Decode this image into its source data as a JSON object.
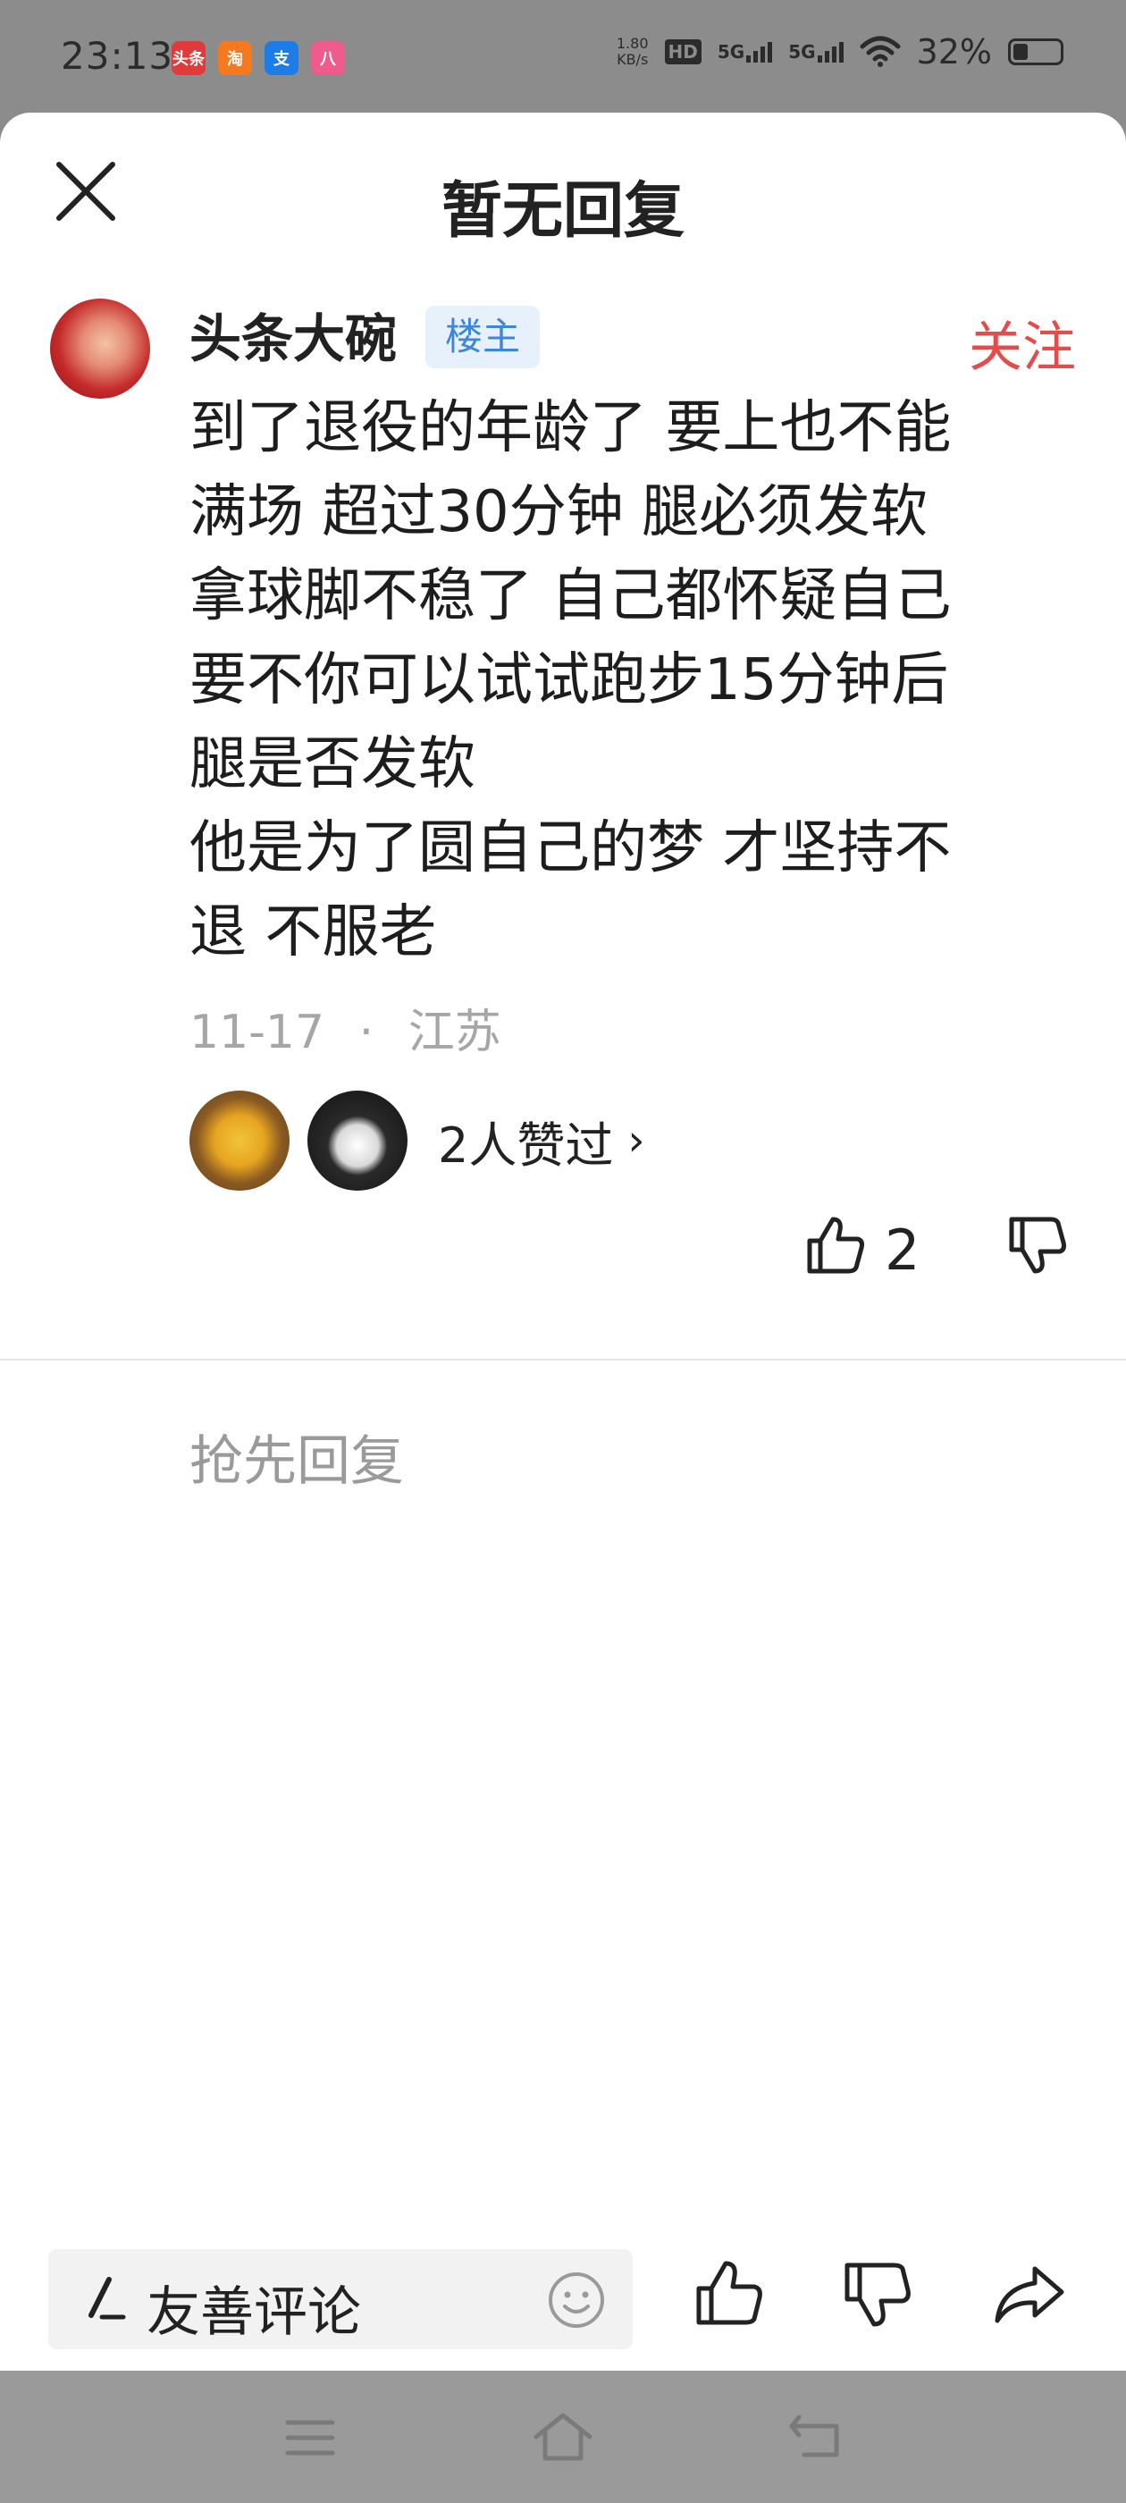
{
  "status_bar": {
    "time": "23:13",
    "apps": [
      {
        "label": "头条",
        "color": "#e03a3a"
      },
      {
        "label": "淘",
        "color": "#f57a1f"
      },
      {
        "label": "支",
        "color": "#1e7ce8"
      },
      {
        "label": "八",
        "color": "#ef5b8d"
      }
    ],
    "network_speed_value": "1.80",
    "network_speed_unit": "KB/s",
    "hd_label": "HD",
    "sim1_label": "5G",
    "sim2_label": "5G",
    "battery": "32%"
  },
  "sheet": {
    "title": "暂无回复"
  },
  "comment": {
    "username": "头条大碗",
    "badge": "楼主",
    "follow_label": "关注",
    "text": "到了退役的年龄了 要上也不能\n满场 超过30分钟 腿必须发软\n拿球脚不稳了 自己都怀疑自己\n要不你可以试试跑步15分钟后\n腿是否发软\n他是为了圆自己的梦 才坚持不\n退 不服老",
    "date": "11-17",
    "separator": "·",
    "location": "江苏",
    "likers_text": "2人赞过",
    "likers_chevron": "›",
    "like_count": "2"
  },
  "replies": {
    "placeholder": "抢先回复"
  },
  "composer": {
    "placeholder": "友善评论"
  },
  "colors": {
    "follow": "#e44b4b",
    "badge_bg": "#e7f1fb",
    "badge_text": "#3f86d4"
  }
}
